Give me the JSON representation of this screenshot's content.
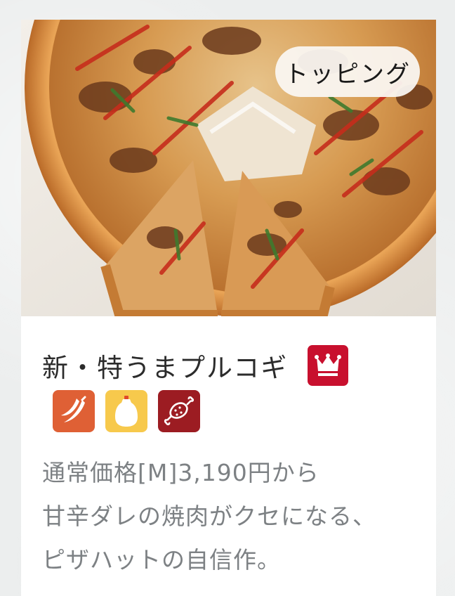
{
  "badge": {
    "topping_label": "トッピング"
  },
  "product": {
    "name": "新・特うまプルコギ",
    "crown_icon": "crown-icon",
    "feature_icons": [
      "chili-pepper-icon",
      "mayonnaise-bottle-icon",
      "meat-icon"
    ]
  },
  "description": {
    "price_line": "通常価格[M]3,190円から",
    "line1": "甘辛ダレの焼肉がクセになる、",
    "line2": "ピザハットの自信作。"
  },
  "colors": {
    "crown_badge": "#c8102e",
    "chili_icon_bg": "#df6035",
    "mayo_icon_bg": "#f7c94c",
    "meat_icon_bg": "#9c1c22",
    "description_text": "#7d8184"
  }
}
